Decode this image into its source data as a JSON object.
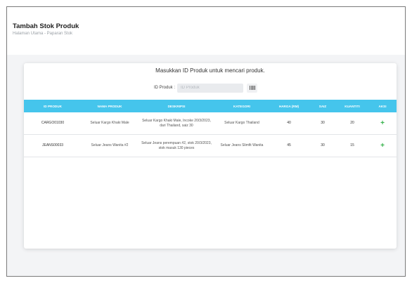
{
  "header": {
    "title": "Tambah Stok Produk",
    "breadcrumb": "Halaman Utama - Paparan Stok"
  },
  "search": {
    "prompt": "Masukkan ID Produk untuk mencari produk.",
    "label": "ID Produk :",
    "placeholder": "ID Produk",
    "button_icon": "barcode-icon"
  },
  "table": {
    "columns": [
      "ID PRODUK",
      "NAMA PRODUK",
      "DESKRIPSI",
      "KATEGORI",
      "HARGA (RM)",
      "SAIZ",
      "KUANTITI",
      "AKSI"
    ],
    "rows": [
      {
        "id": "CARGO01030",
        "name": "Seluar Kargo Khaki Male",
        "description": "Seluar Kargo Khaki Male, Incoke 20/3/2023, dari Thailand, saiz 30",
        "category": "Seluar Kargo Thailand",
        "price": "40",
        "size": "30",
        "quantity": "20",
        "action": "+"
      },
      {
        "id": "JEANS00033",
        "name": "Seluar Jeans Wanita #2",
        "description": "Seluar Jeans perempuan #2, stok 20/3/2023, stok masuk 130 pieces",
        "category": "Seluar Jeans Slimfit Wanita",
        "price": "45",
        "size": "30",
        "quantity": "15",
        "action": "+"
      }
    ]
  },
  "colors": {
    "table_header": "#45c5ec",
    "action": "#35b14a"
  }
}
